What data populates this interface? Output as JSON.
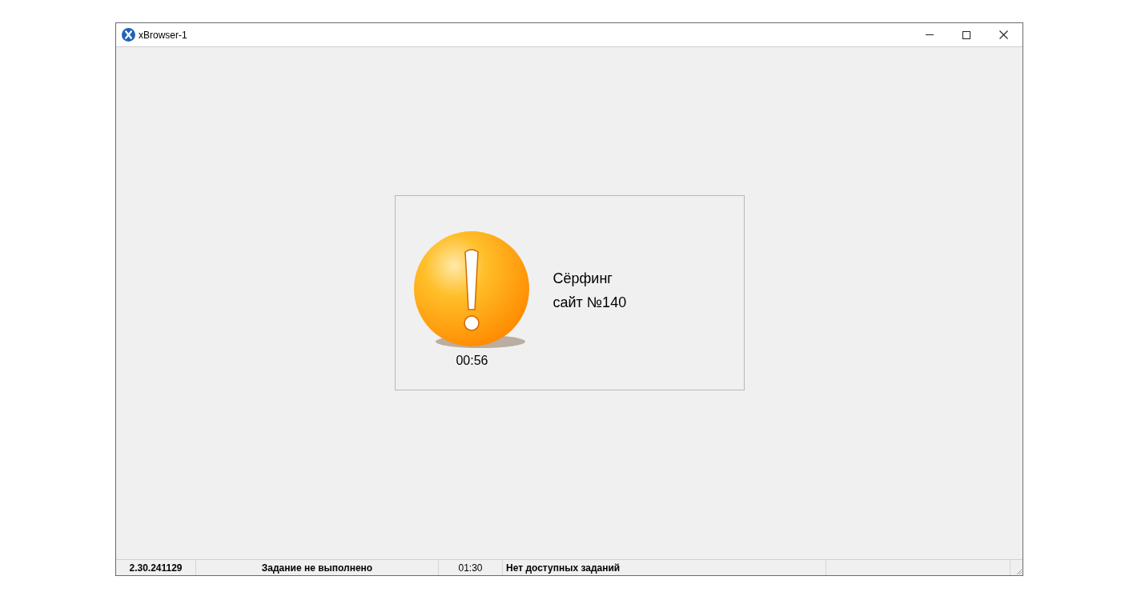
{
  "window": {
    "title": "xBrowser-1"
  },
  "task": {
    "timer": "00:56",
    "lines": [
      "Сёрфинг",
      "сайт №140"
    ]
  },
  "status_bar": [
    "2.30.241129",
    "Задание не выполнено",
    "01:30",
    "Нет доступных заданий"
  ]
}
